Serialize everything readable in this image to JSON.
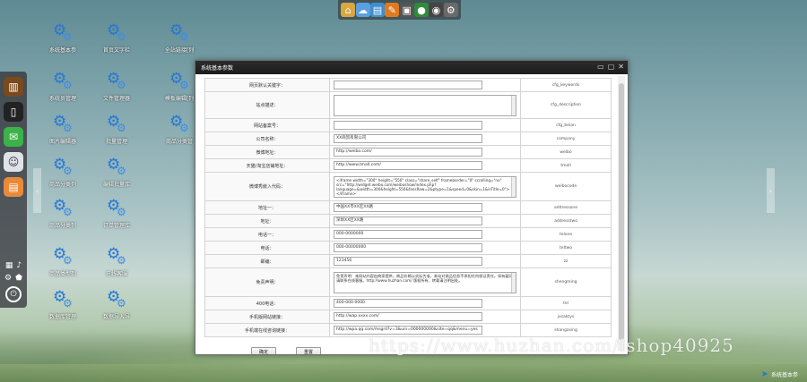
{
  "top_dock": [
    {
      "icon": "home-icon",
      "glyph": "⌂",
      "color": "#d9a640"
    },
    {
      "icon": "cloud-icon",
      "glyph": "☁",
      "color": "#5aa0e0"
    },
    {
      "icon": "briefcase-icon",
      "glyph": "▤",
      "color": "#3f8fd0"
    },
    {
      "icon": "leaf-icon",
      "glyph": "✎",
      "color": "#e07a20"
    },
    {
      "icon": "monitor-icon",
      "glyph": "▣",
      "color": "#555555"
    },
    {
      "icon": "user-icon",
      "glyph": "●",
      "color": "#2f8a3c"
    },
    {
      "icon": "globe-icon",
      "glyph": "◉",
      "color": "#444444"
    },
    {
      "icon": "gear-icon",
      "glyph": "⚙",
      "color": "#6a6a6a"
    }
  ],
  "left_bar": {
    "apps": [
      {
        "icon": "books-icon",
        "glyph": "▥",
        "color": "#7a4a1d"
      },
      {
        "icon": "document-icon",
        "glyph": "▯",
        "color": "#222222"
      },
      {
        "icon": "chat-icon",
        "glyph": "✉",
        "color": "#3bb34a"
      },
      {
        "icon": "finder-icon",
        "glyph": "☺",
        "color": "#dfe3e8"
      },
      {
        "icon": "notes-icon",
        "glyph": "▤",
        "color": "#e98a3a"
      }
    ],
    "mini": [
      "▦",
      "♪",
      "⚙",
      "⬟"
    ],
    "power_glyph": "⏻"
  },
  "desktop_icons": [
    {
      "label": "系统基本参"
    },
    {
      "label": "首页文字栏"
    },
    {
      "label": "全站链接[列"
    },
    {
      "label": "系统员管理"
    },
    {
      "label": "文件管理器"
    },
    {
      "label": "模板编辑[列"
    },
    {
      "label": "图片编辑器"
    },
    {
      "label": "批量管理"
    },
    {
      "label": "商品分类管"
    },
    {
      "label": "商品分类列"
    },
    {
      "label": "编辑批量库"
    },
    {
      "label": "商品分类列"
    },
    {
      "label": "订单管理库"
    },
    {
      "label": "商品类型列"
    },
    {
      "label": "在线客服"
    },
    {
      "label": "数据库管理"
    },
    {
      "label": "数据导入导"
    }
  ],
  "window": {
    "title": "系统基本参数",
    "controls": [
      "✕",
      "▢",
      "▭"
    ],
    "rows": [
      {
        "label": "网页默认关键字：",
        "value": "",
        "key": "cfg_keywords",
        "type": "input"
      },
      {
        "label": "站点描述：",
        "value": "",
        "key": "cfg_description",
        "type": "textarea"
      },
      {
        "label": "网站备案号：",
        "value": "",
        "key": "cfg_beian",
        "type": "input"
      },
      {
        "label": "公司名称：",
        "value": "XX商贸有限公司",
        "key": "company",
        "type": "input"
      },
      {
        "label": "微博地址：",
        "value": "http://weibo.com/",
        "key": "weibo",
        "type": "input"
      },
      {
        "label": "天猫/淘宝店铺地址：",
        "value": "http://www.tmall.com/",
        "key": "tmall",
        "type": "input"
      },
      {
        "label": "微博秀嵌入代码：",
        "value": "<iframe width=\"300\" height=\"550\" class=\"share_self\" frameborder=\"0\" scrolling=\"no\" src=\"http://widget.weibo.com/weiboshow/index.php?language=&width=300&height=550&fansRow=2&ptype=1&speed=0&skin=1&isTitle=0\"></iframe>",
        "key": "weibocode",
        "type": "textarea"
      },
      {
        "label": "地址一：",
        "value": "中国XX市XX区XX路",
        "key": "addressone",
        "type": "input"
      },
      {
        "label": "地址：",
        "value": "深圳XX区XX路",
        "key": "addresstwo",
        "type": "input"
      },
      {
        "label": "电话一：",
        "value": "000-0000000",
        "key": "telone",
        "type": "input"
      },
      {
        "label": "电话：",
        "value": "000-00000000",
        "key": "teltwo",
        "type": "input"
      },
      {
        "label": "邮编：",
        "value": "123456",
        "key": "zz",
        "type": "input"
      },
      {
        "label": "免责声明：",
        "value": "免责声明：本网站内容由商家提供，商品价格以实际为准，本站对商品信息不承担任何保证责任。如有疑问请联系在线客服。http://www.huzhan.com/ 版权所有，转载请注明出处。",
        "key": "shengming",
        "type": "textarea"
      },
      {
        "label": "400电话：",
        "value": "400-000-0000",
        "key": "tel",
        "type": "input"
      },
      {
        "label": "手机版网站链接：",
        "value": "http://wap.xxxx.com/",
        "key": "jxsaktys",
        "type": "input"
      },
      {
        "label": "手机端在线咨询链接：",
        "value": "http://wpa.qq.com/msgrd?v=3&uin=000000000&site=qq&menu=yes",
        "key": "shangzxing",
        "type": "input"
      }
    ],
    "buttons": {
      "ok": "确定",
      "reset": "重置"
    }
  },
  "watermark": "https://www.huzhan.com/ishop40925",
  "corner_logo": "系统基本参"
}
